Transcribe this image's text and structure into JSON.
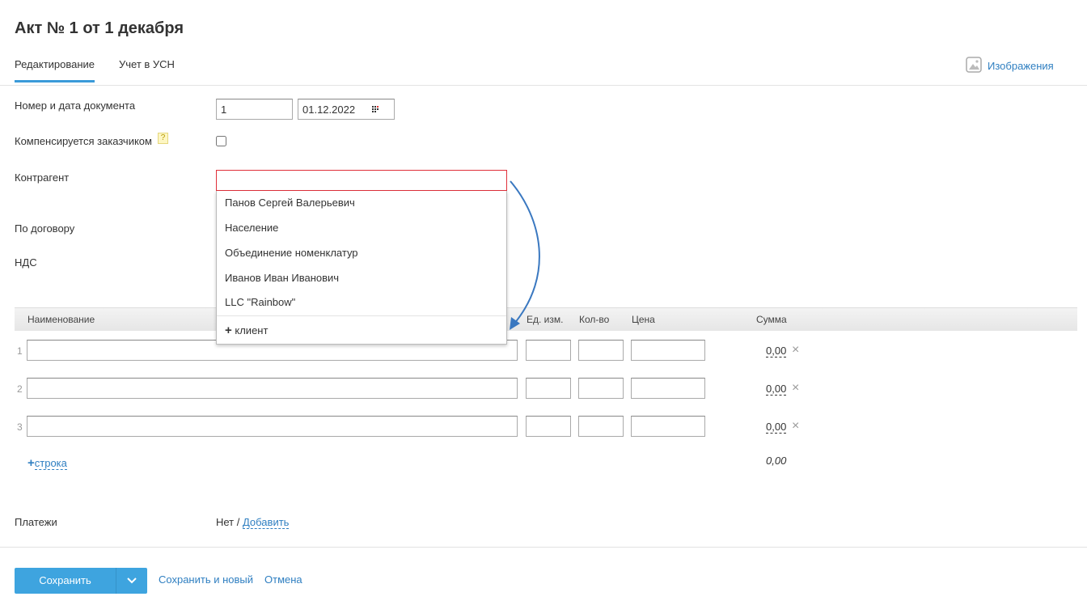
{
  "title": "Акт № 1 от 1 декабря",
  "tabs": [
    {
      "label": "Редактирование"
    },
    {
      "label": "Учет в УСН"
    }
  ],
  "images_link": "Изображения",
  "form": {
    "doc_label": "Номер и дата документа",
    "doc_number": "1",
    "doc_date": "01.12.2022",
    "compensated_label": "Компенсируется заказчиком",
    "help": "?",
    "counterparty_label": "Контрагент",
    "counterparty_value": "",
    "contract_label": "По договору",
    "vat_label": "НДС"
  },
  "dropdown": {
    "items": [
      "Панов Сергей Валерьевич",
      "Население",
      "Объединение номенклатур",
      "Иванов Иван Иванович",
      "LLC \"Rainbow\""
    ],
    "add_label": "клиент",
    "add_icon": "+"
  },
  "table": {
    "headers": {
      "name": "Наименование",
      "unit": "Ед. изм.",
      "qty": "Кол-во",
      "price": "Цена",
      "sum": "Сумма"
    },
    "rows": [
      {
        "n": "1",
        "sum": "0,00"
      },
      {
        "n": "2",
        "sum": "0,00"
      },
      {
        "n": "3",
        "sum": "0,00"
      }
    ],
    "delete_icon": "×",
    "add_row": "строка",
    "add_icon": "+",
    "total": "0,00"
  },
  "payments": {
    "label": "Платежи",
    "value": "Нет",
    "sep": " / ",
    "add": "Добавить"
  },
  "footer": {
    "save": "Сохранить",
    "save_new": "Сохранить и новый",
    "cancel": "Отмена"
  },
  "colors": {
    "accent": "#3a9ad9",
    "link": "#2f7fc1",
    "error": "#e0303a"
  }
}
